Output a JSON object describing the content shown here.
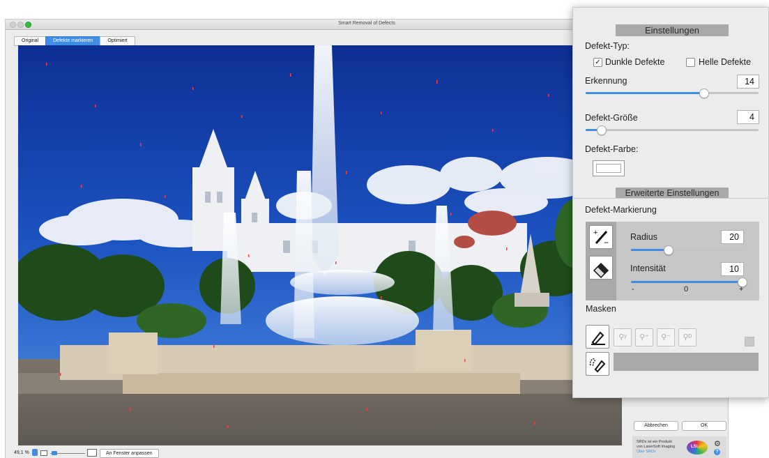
{
  "window": {
    "title": "Smart Removal of Defects",
    "tabs": [
      {
        "label": "Original",
        "active": false
      },
      {
        "label": "Defekte markieren",
        "active": true
      },
      {
        "label": "Optimiert",
        "active": false
      }
    ]
  },
  "statusbar": {
    "zoom": "49,1 %",
    "fit_button": "An Fenster anpassen"
  },
  "actions": {
    "cancel": "Abbrechen",
    "ok": "OK"
  },
  "about": {
    "line1": "SRDx ist ein Produkt",
    "line2": "von LaserSoft Imaging",
    "link": "Über SRDx",
    "logo_text": "LSI"
  },
  "panel": {
    "section_title": "Einstellungen",
    "defect_type_label": "Defekt-Typ:",
    "dark_defects": {
      "label": "Dunkle Defekte",
      "checked": true,
      "check_glyph": "✓"
    },
    "light_defects": {
      "label": "Helle Defekte",
      "checked": false
    },
    "detection": {
      "label": "Erkennung",
      "value": "14",
      "fraction": 0.68
    },
    "defect_size": {
      "label": "Defekt-Größe",
      "value": "4",
      "fraction": 0.09
    },
    "defect_color_label": "Defekt-Farbe:",
    "advanced_title": "Erweiterte Einstellungen",
    "marking_label": "Defekt-Markierung",
    "radius": {
      "label": "Radius",
      "value": "20",
      "fraction": 0.33
    },
    "intensity": {
      "label": "Intensität",
      "value": "10",
      "fraction": 0.98,
      "min_label": "-",
      "mid_label": "0",
      "max_label": "+"
    },
    "masks_label": "Masken",
    "mask_tool_glyphs": [
      "⚲ʸ",
      "⚲⁺",
      "⚲⁻",
      "⚲ᴰ"
    ]
  },
  "colors": {
    "accent": "#3f8de4",
    "panel_bg": "#ececec",
    "header_gray": "#a9a9a9"
  }
}
